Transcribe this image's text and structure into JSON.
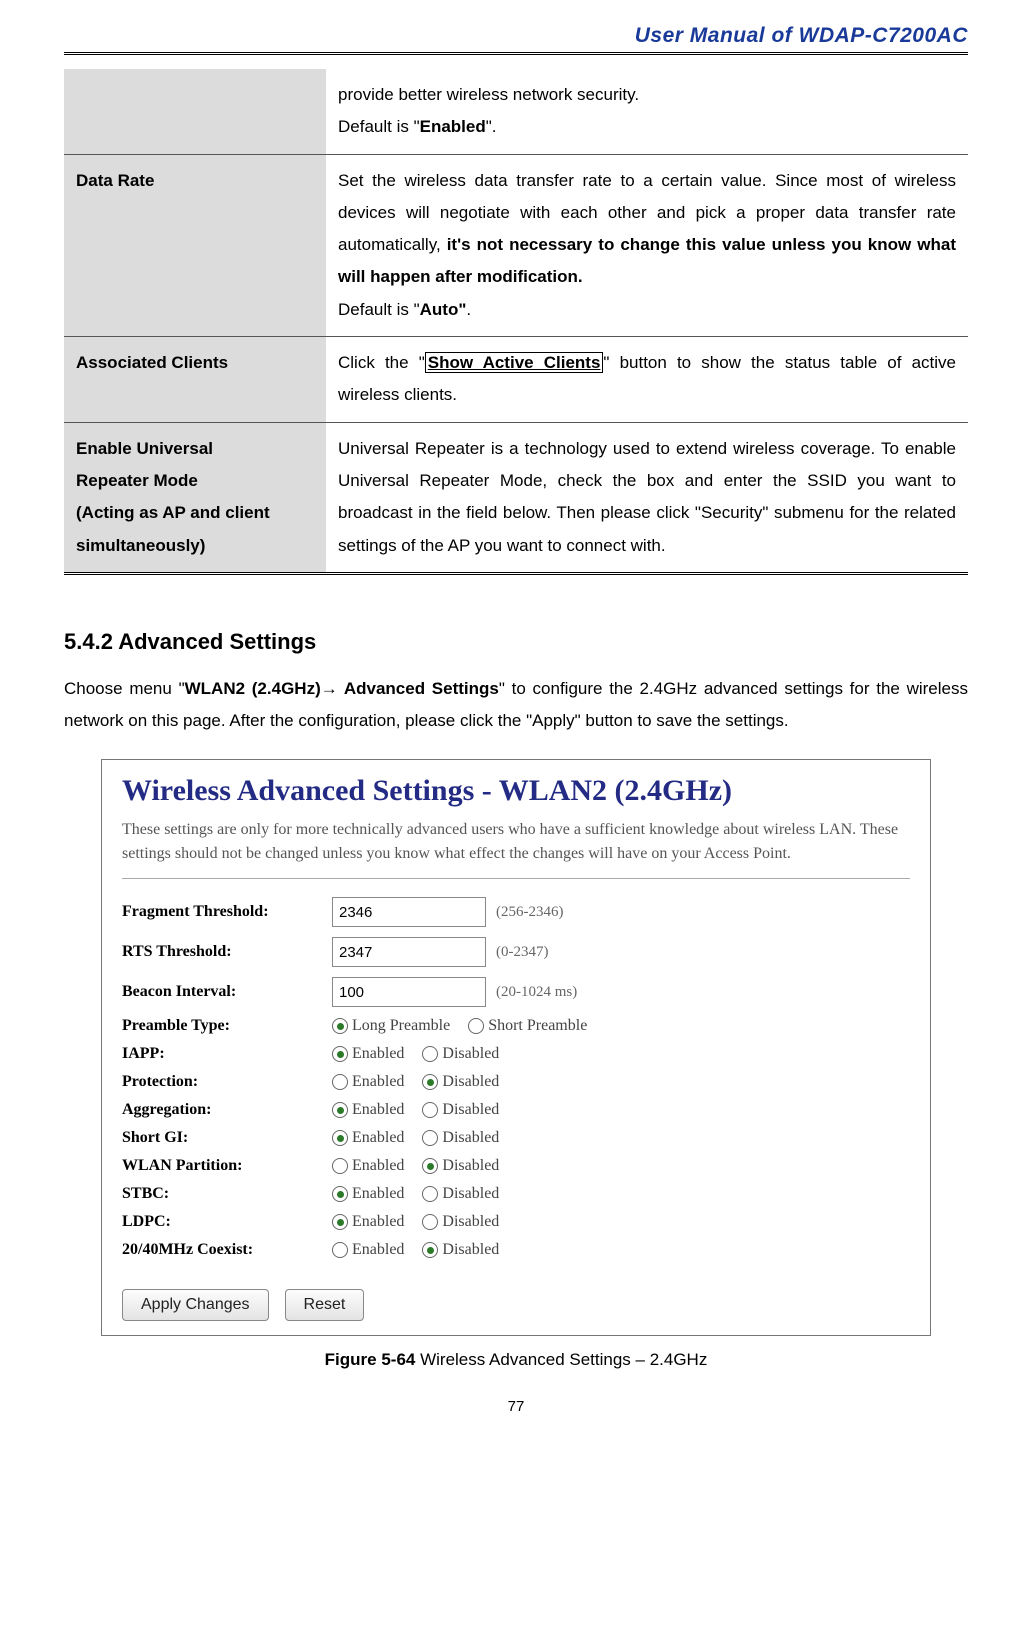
{
  "header": {
    "title": "User Manual of WDAP-C7200AC"
  },
  "table": {
    "row0": {
      "label": "",
      "desc_a": "provide better wireless network security.",
      "desc_b": "Default is \"",
      "desc_b_bold": "Enabled",
      "desc_b_end": "\"."
    },
    "row1": {
      "label": "Data Rate",
      "p1a": "Set the wireless data transfer rate to a certain value. Since most of wireless devices will negotiate with each other and pick a proper data transfer rate automatically, ",
      "p1b": "it's not necessary to change this value unless you know what will happen after modification.",
      "p2a": "Default is \"",
      "p2b": "Auto\"",
      "p2c": "."
    },
    "row2": {
      "label": "Associated Clients",
      "p_a": "Click the \"",
      "btn": "Show Active Clients",
      "p_b": "\" button to show the status table of active wireless clients."
    },
    "row3": {
      "label_a": "Enable Universal",
      "label_b": "Repeater Mode",
      "label_c": "(Acting as AP and client",
      "label_d": "simultaneously)",
      "desc": "Universal Repeater is a technology used to extend wireless coverage. To enable Universal Repeater Mode, check the box and enter the SSID you want to broadcast in the field below. Then please click \"Security\" submenu for the related settings of the AP you want to connect with."
    }
  },
  "section": {
    "heading": "5.4.2  Advanced Settings",
    "body_a": "Choose menu \"",
    "body_b": "WLAN2 (2.4GHz)",
    "body_arrow": "→",
    "body_c": " Advanced Settings",
    "body_d": "\" to configure the 2.4GHz advanced settings for the wireless network on this page. After the configuration, please click the \"Apply\" button to save the settings."
  },
  "screenshot": {
    "title": "Wireless Advanced Settings - WLAN2 (2.4GHz)",
    "desc": "These settings are only for more technically advanced users who have a sufficient knowledge about wireless LAN. These settings should not be changed unless you know what effect the changes will have on your Access Point.",
    "frag": {
      "label": "Fragment Threshold:",
      "value": "2346",
      "hint": "(256-2346)"
    },
    "rts": {
      "label": "RTS Threshold:",
      "value": "2347",
      "hint": "(0-2347)"
    },
    "beacon": {
      "label": "Beacon Interval:",
      "value": "100",
      "hint": "(20-1024 ms)"
    },
    "preamble": {
      "label": "Preamble Type:",
      "opt1": "Long Preamble",
      "opt2": "Short Preamble",
      "sel": 0
    },
    "iapp": {
      "label": "IAPP:",
      "opt1": "Enabled",
      "opt2": "Disabled",
      "sel": 0
    },
    "protection": {
      "label": "Protection:",
      "opt1": "Enabled",
      "opt2": "Disabled",
      "sel": 1
    },
    "aggregation": {
      "label": "Aggregation:",
      "opt1": "Enabled",
      "opt2": "Disabled",
      "sel": 0
    },
    "shortgi": {
      "label": "Short GI:",
      "opt1": "Enabled",
      "opt2": "Disabled",
      "sel": 0
    },
    "partition": {
      "label": "WLAN Partition:",
      "opt1": "Enabled",
      "opt2": "Disabled",
      "sel": 1
    },
    "stbc": {
      "label": "STBC:",
      "opt1": "Enabled",
      "opt2": "Disabled",
      "sel": 0
    },
    "ldpc": {
      "label": "LDPC:",
      "opt1": "Enabled",
      "opt2": "Disabled",
      "sel": 0
    },
    "coexist": {
      "label": "20/40MHz Coexist:",
      "opt1": "Enabled",
      "opt2": "Disabled",
      "sel": 1
    },
    "apply": "Apply Changes",
    "reset": "Reset"
  },
  "figcap": {
    "bold": "Figure 5-64",
    "rest": " Wireless Advanced Settings – 2.4GHz"
  },
  "pagenum": "77"
}
